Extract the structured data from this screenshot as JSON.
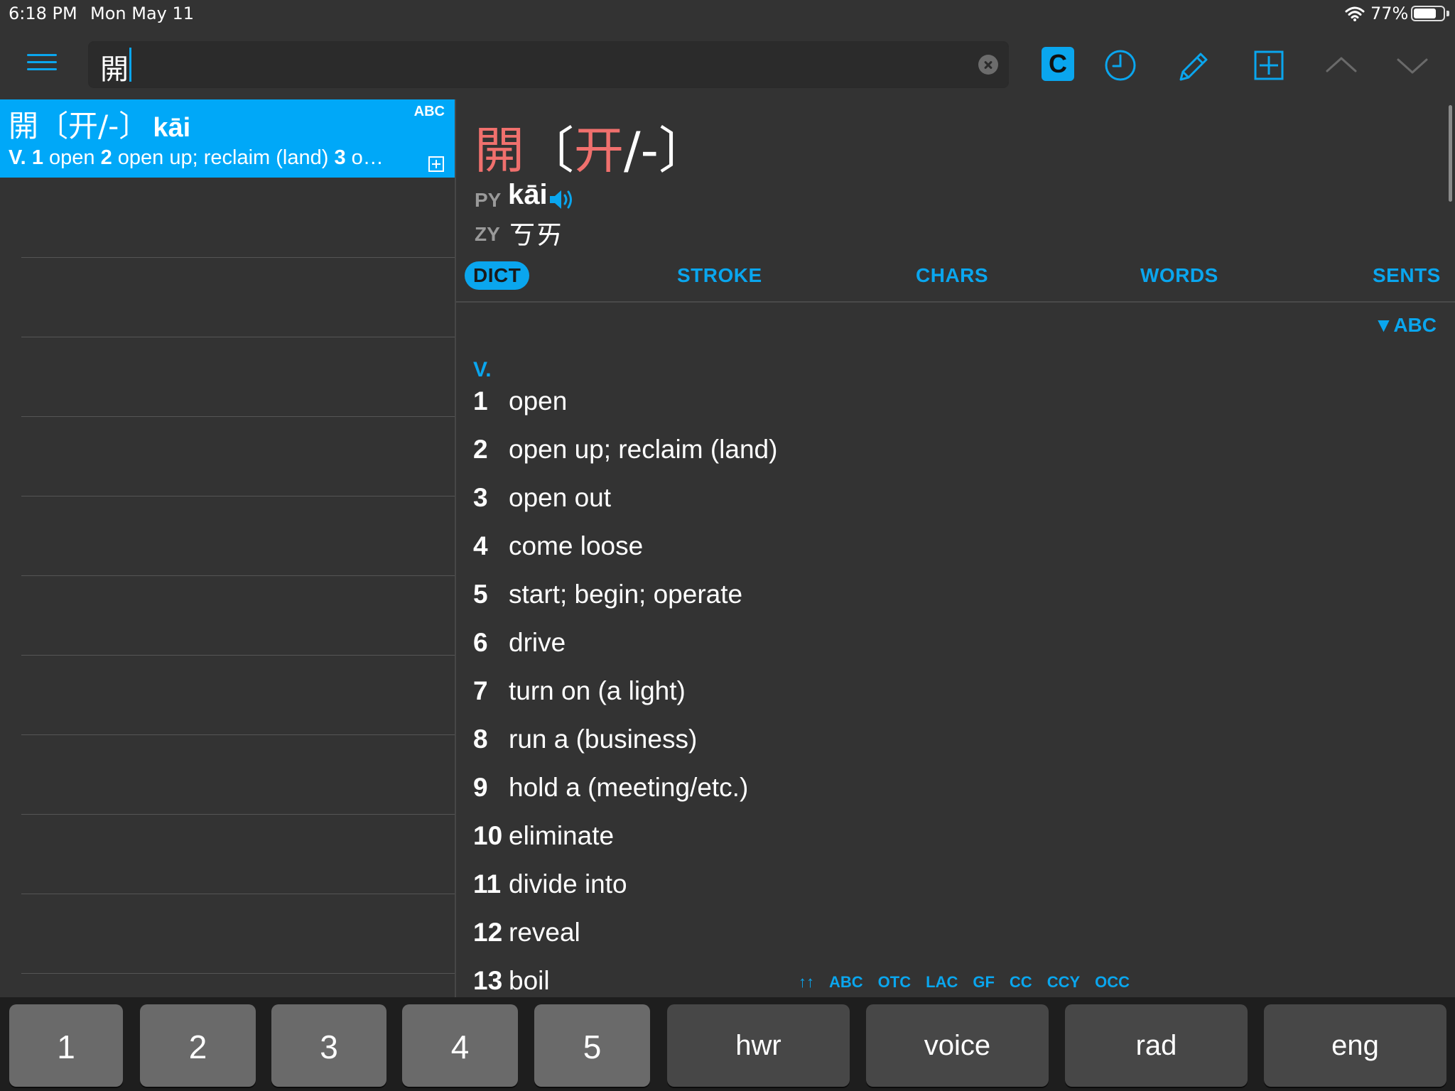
{
  "status_bar": {
    "time": "6:18 PM",
    "date": "Mon May 11",
    "battery_percent": "77%",
    "battery_level": 0.77
  },
  "toolbar": {
    "search_value": "開",
    "c_button_label": "C",
    "icons": [
      "menu-icon",
      "clear-icon",
      "history-icon",
      "pencil-icon",
      "add-icon",
      "chevron-up-icon",
      "chevron-down-icon"
    ]
  },
  "list": {
    "selected_entry": {
      "headword": "開〔开/-〕",
      "pinyin": "kāi",
      "badge": "ABC",
      "pos": "V.",
      "n1": "1",
      "s1": "open",
      "n2": "2",
      "s2": "open up; reclaim (land)",
      "n3": "3",
      "s3": "o…"
    }
  },
  "detail": {
    "char_trad": "開",
    "bracket_open": "〔",
    "char_simp": "开",
    "rest": "/-",
    "bracket_close": "〕",
    "py_label": "PY",
    "pinyin": "kāi",
    "zy_label": "ZY",
    "zhuyin": "ㄎㄞ",
    "tabs": [
      "DICT",
      "STROKE",
      "CHARS",
      "WORDS",
      "SENTS"
    ],
    "active_tab": "DICT",
    "sort_label": "▼ABC",
    "pos": "V.",
    "senses": [
      {
        "num": "1",
        "text": "open"
      },
      {
        "num": "2",
        "text": "open up; reclaim (land)"
      },
      {
        "num": "3",
        "text": "open out"
      },
      {
        "num": "4",
        "text": "come loose"
      },
      {
        "num": "5",
        "text": "start; begin; operate"
      },
      {
        "num": "6",
        "text": "drive"
      },
      {
        "num": "7",
        "text": "turn on (a light)"
      },
      {
        "num": "8",
        "text": "run a (business)"
      },
      {
        "num": "9",
        "text": "hold a (meeting/etc.)"
      },
      {
        "num": "10",
        "text": "eliminate"
      },
      {
        "num": "11",
        "text": "divide into"
      },
      {
        "num": "12",
        "text": "reveal"
      },
      {
        "num": "13",
        "text": "boil"
      }
    ],
    "sources": [
      "↑↑",
      "ABC",
      "OTC",
      "LAC",
      "GF",
      "CC",
      "CCY",
      "OCC"
    ]
  },
  "keyboard": {
    "keys": [
      "1",
      "2",
      "3",
      "4",
      "5",
      "hwr",
      "voice",
      "rad",
      "eng"
    ]
  },
  "colors": {
    "accent": "#0aa6ee",
    "selected_row": "#00a8f8",
    "headword": "#f0706d",
    "background": "#333333"
  }
}
